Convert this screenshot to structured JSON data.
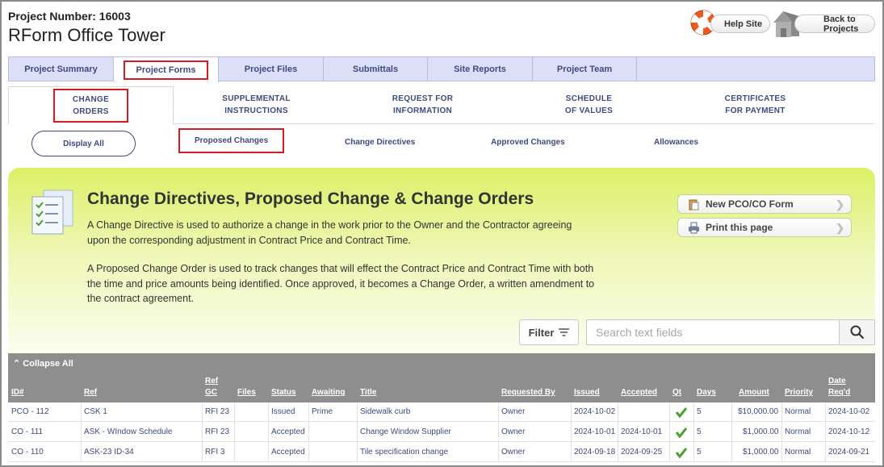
{
  "header": {
    "project_number": "Project Number: 16003",
    "project_title": "RForm Office Tower",
    "help_site": "Help Site",
    "back_to_projects": "Back to Projects"
  },
  "main_tabs": [
    "Project Summary",
    "Project Forms",
    "Project Files",
    "Submittals",
    "Site Reports",
    "Project Team"
  ],
  "sub_tabs": [
    [
      "CHANGE",
      "ORDERS"
    ],
    [
      "SUPPLEMENTAL",
      "INSTRUCTIONS"
    ],
    [
      "REQUEST FOR",
      "INFORMATION"
    ],
    [
      "SCHEDULE",
      "OF VALUES"
    ],
    [
      "CERTIFICATES",
      "FOR PAYMENT"
    ]
  ],
  "filters": {
    "display_all": "Display All",
    "proposed": "Proposed Changes",
    "directives": "Change Directives",
    "approved": "Approved Changes",
    "allowances": "Allowances"
  },
  "panel": {
    "title": "Change Directives, Proposed Change & Change Orders",
    "para1": "A Change Directive is used to authorize a change in the work prior to the Owner and the Contractor agreeing upon the corresponding adjustment in Contract Price and Contract Time.",
    "para2": "A Proposed Change Order is used to track changes that will effect the Contract Price and Contract Time with both the time and price amounts being identified. Once approved, it becomes a Change Order, a written amendment to the contract agreement.",
    "new_form": "New PCO/CO Form",
    "print": "Print this page"
  },
  "search": {
    "filter_label": "Filter",
    "placeholder": "Search text fields"
  },
  "table": {
    "collapse_all": "Collapse All",
    "headers": {
      "id": "ID#",
      "ref": "Ref",
      "ref_gc_1": "Ref",
      "ref_gc_2": "GC",
      "files": "Files",
      "status": "Status",
      "awaiting": "Awaiting",
      "title": "Title",
      "requested_by": "Requested By",
      "issued": "Issued",
      "accepted": "Accepted",
      "qt": "Qt",
      "days": "Days",
      "amount": "Amount",
      "priority": "Priority",
      "date_req_1": "Date",
      "date_req_2": "Req'd"
    },
    "rows": [
      {
        "id": "PCO - 112",
        "ref": "CSK 1",
        "ref_gc": "RFI 23",
        "status": "Issued",
        "awaiting": "Prime",
        "title": "Sidewalk curb",
        "requested_by": "Owner",
        "issued": "2024-10-02",
        "accepted": "",
        "days": "5",
        "amount": "$10,000.00",
        "priority": "Normal",
        "date_req": "2024-10-02"
      },
      {
        "id": "CO - 111",
        "ref": "ASK - WIndow Schedule",
        "ref_gc": "RFI 23",
        "status": "Accepted",
        "awaiting": "",
        "title": "Change Window Supplier",
        "requested_by": "Owner",
        "issued": "2024-10-01",
        "accepted": "2024-10-01",
        "days": "5",
        "amount": "$1,000.00",
        "priority": "Normal",
        "date_req": "2024-10-12"
      },
      {
        "id": "CO - 110",
        "ref": "ASK-23 ID-34",
        "ref_gc": "RFI 3",
        "status": "Accepted",
        "awaiting": "",
        "title": "Tile specification change",
        "requested_by": "Owner",
        "issued": "2024-09-18",
        "accepted": "2024-09-25",
        "days": "5",
        "amount": "$1,000.00",
        "priority": "Normal",
        "date_req": "2024-09-21"
      }
    ]
  },
  "colors": {
    "accent": "#3e4a80",
    "highlight": "#d71920",
    "panel_green": "#dcf067",
    "table_header": "#8e8e8e",
    "check_green": "#4aa02c"
  }
}
